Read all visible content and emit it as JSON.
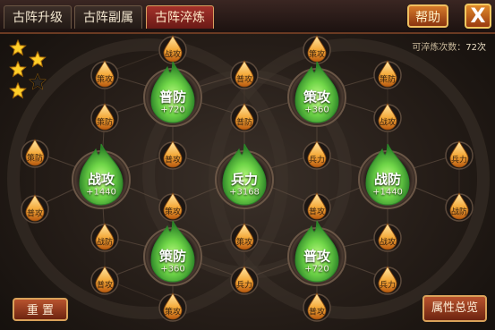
{
  "tabs": [
    {
      "label": "古阵升级"
    },
    {
      "label": "古阵副属"
    },
    {
      "label": "古阵淬炼",
      "active": true
    }
  ],
  "header": {
    "help_label": "帮助",
    "close_label": "X"
  },
  "refine_count": {
    "label": "可淬炼次数：",
    "value": "72次"
  },
  "stars": {
    "filled": 5,
    "total": 6
  },
  "core_nodes": [
    {
      "name": "普防",
      "value": "+720"
    },
    {
      "name": "策攻",
      "value": "+360"
    },
    {
      "name": "战攻",
      "value": "+1440"
    },
    {
      "name": "兵力",
      "value": "+3168"
    },
    {
      "name": "战防",
      "value": "+1440"
    },
    {
      "name": "策防",
      "value": "+360"
    },
    {
      "name": "普攻",
      "value": "+720"
    }
  ],
  "small_nodes": [
    "战攻",
    "策攻",
    "策攻",
    "普攻",
    "策防",
    "策防",
    "普防",
    "战攻",
    "策防",
    "普攻",
    "兵力",
    "兵力",
    "普攻",
    "策攻",
    "普攻",
    "战防",
    "战防",
    "策攻",
    "战攻",
    "普攻",
    "兵力",
    "兵力",
    "策攻",
    "普攻",
    "策防",
    "普防",
    "普攻",
    "战攻",
    "策防",
    "战防"
  ],
  "buttons": {
    "reset": "重 置",
    "summary": "属性总览"
  },
  "colors": {
    "flame_core": "#7fe35a",
    "flame_dark": "#1f7a22",
    "drop_light": "#ffd27a",
    "drop_dark": "#c86a12",
    "tab_active": "#a4312a"
  }
}
